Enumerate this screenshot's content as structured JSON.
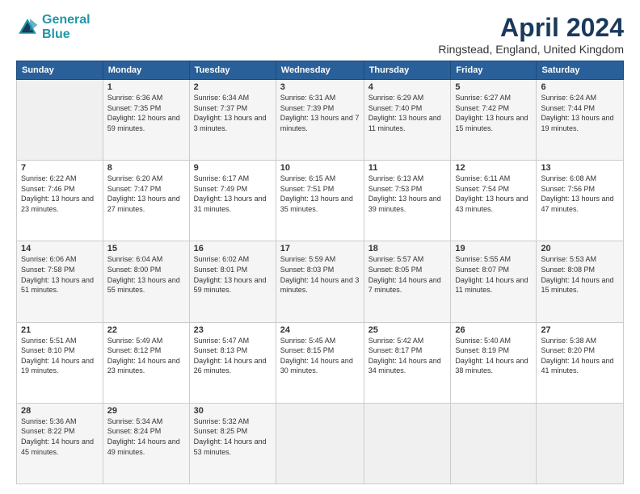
{
  "header": {
    "logo_general": "General",
    "logo_blue": "Blue",
    "month_year": "April 2024",
    "location": "Ringstead, England, United Kingdom"
  },
  "days_of_week": [
    "Sunday",
    "Monday",
    "Tuesday",
    "Wednesday",
    "Thursday",
    "Friday",
    "Saturday"
  ],
  "weeks": [
    [
      {
        "day": "",
        "sunrise": "",
        "sunset": "",
        "daylight": ""
      },
      {
        "day": "1",
        "sunrise": "Sunrise: 6:36 AM",
        "sunset": "Sunset: 7:35 PM",
        "daylight": "Daylight: 12 hours and 59 minutes."
      },
      {
        "day": "2",
        "sunrise": "Sunrise: 6:34 AM",
        "sunset": "Sunset: 7:37 PM",
        "daylight": "Daylight: 13 hours and 3 minutes."
      },
      {
        "day": "3",
        "sunrise": "Sunrise: 6:31 AM",
        "sunset": "Sunset: 7:39 PM",
        "daylight": "Daylight: 13 hours and 7 minutes."
      },
      {
        "day": "4",
        "sunrise": "Sunrise: 6:29 AM",
        "sunset": "Sunset: 7:40 PM",
        "daylight": "Daylight: 13 hours and 11 minutes."
      },
      {
        "day": "5",
        "sunrise": "Sunrise: 6:27 AM",
        "sunset": "Sunset: 7:42 PM",
        "daylight": "Daylight: 13 hours and 15 minutes."
      },
      {
        "day": "6",
        "sunrise": "Sunrise: 6:24 AM",
        "sunset": "Sunset: 7:44 PM",
        "daylight": "Daylight: 13 hours and 19 minutes."
      }
    ],
    [
      {
        "day": "7",
        "sunrise": "Sunrise: 6:22 AM",
        "sunset": "Sunset: 7:46 PM",
        "daylight": "Daylight: 13 hours and 23 minutes."
      },
      {
        "day": "8",
        "sunrise": "Sunrise: 6:20 AM",
        "sunset": "Sunset: 7:47 PM",
        "daylight": "Daylight: 13 hours and 27 minutes."
      },
      {
        "day": "9",
        "sunrise": "Sunrise: 6:17 AM",
        "sunset": "Sunset: 7:49 PM",
        "daylight": "Daylight: 13 hours and 31 minutes."
      },
      {
        "day": "10",
        "sunrise": "Sunrise: 6:15 AM",
        "sunset": "Sunset: 7:51 PM",
        "daylight": "Daylight: 13 hours and 35 minutes."
      },
      {
        "day": "11",
        "sunrise": "Sunrise: 6:13 AM",
        "sunset": "Sunset: 7:53 PM",
        "daylight": "Daylight: 13 hours and 39 minutes."
      },
      {
        "day": "12",
        "sunrise": "Sunrise: 6:11 AM",
        "sunset": "Sunset: 7:54 PM",
        "daylight": "Daylight: 13 hours and 43 minutes."
      },
      {
        "day": "13",
        "sunrise": "Sunrise: 6:08 AM",
        "sunset": "Sunset: 7:56 PM",
        "daylight": "Daylight: 13 hours and 47 minutes."
      }
    ],
    [
      {
        "day": "14",
        "sunrise": "Sunrise: 6:06 AM",
        "sunset": "Sunset: 7:58 PM",
        "daylight": "Daylight: 13 hours and 51 minutes."
      },
      {
        "day": "15",
        "sunrise": "Sunrise: 6:04 AM",
        "sunset": "Sunset: 8:00 PM",
        "daylight": "Daylight: 13 hours and 55 minutes."
      },
      {
        "day": "16",
        "sunrise": "Sunrise: 6:02 AM",
        "sunset": "Sunset: 8:01 PM",
        "daylight": "Daylight: 13 hours and 59 minutes."
      },
      {
        "day": "17",
        "sunrise": "Sunrise: 5:59 AM",
        "sunset": "Sunset: 8:03 PM",
        "daylight": "Daylight: 14 hours and 3 minutes."
      },
      {
        "day": "18",
        "sunrise": "Sunrise: 5:57 AM",
        "sunset": "Sunset: 8:05 PM",
        "daylight": "Daylight: 14 hours and 7 minutes."
      },
      {
        "day": "19",
        "sunrise": "Sunrise: 5:55 AM",
        "sunset": "Sunset: 8:07 PM",
        "daylight": "Daylight: 14 hours and 11 minutes."
      },
      {
        "day": "20",
        "sunrise": "Sunrise: 5:53 AM",
        "sunset": "Sunset: 8:08 PM",
        "daylight": "Daylight: 14 hours and 15 minutes."
      }
    ],
    [
      {
        "day": "21",
        "sunrise": "Sunrise: 5:51 AM",
        "sunset": "Sunset: 8:10 PM",
        "daylight": "Daylight: 14 hours and 19 minutes."
      },
      {
        "day": "22",
        "sunrise": "Sunrise: 5:49 AM",
        "sunset": "Sunset: 8:12 PM",
        "daylight": "Daylight: 14 hours and 23 minutes."
      },
      {
        "day": "23",
        "sunrise": "Sunrise: 5:47 AM",
        "sunset": "Sunset: 8:13 PM",
        "daylight": "Daylight: 14 hours and 26 minutes."
      },
      {
        "day": "24",
        "sunrise": "Sunrise: 5:45 AM",
        "sunset": "Sunset: 8:15 PM",
        "daylight": "Daylight: 14 hours and 30 minutes."
      },
      {
        "day": "25",
        "sunrise": "Sunrise: 5:42 AM",
        "sunset": "Sunset: 8:17 PM",
        "daylight": "Daylight: 14 hours and 34 minutes."
      },
      {
        "day": "26",
        "sunrise": "Sunrise: 5:40 AM",
        "sunset": "Sunset: 8:19 PM",
        "daylight": "Daylight: 14 hours and 38 minutes."
      },
      {
        "day": "27",
        "sunrise": "Sunrise: 5:38 AM",
        "sunset": "Sunset: 8:20 PM",
        "daylight": "Daylight: 14 hours and 41 minutes."
      }
    ],
    [
      {
        "day": "28",
        "sunrise": "Sunrise: 5:36 AM",
        "sunset": "Sunset: 8:22 PM",
        "daylight": "Daylight: 14 hours and 45 minutes."
      },
      {
        "day": "29",
        "sunrise": "Sunrise: 5:34 AM",
        "sunset": "Sunset: 8:24 PM",
        "daylight": "Daylight: 14 hours and 49 minutes."
      },
      {
        "day": "30",
        "sunrise": "Sunrise: 5:32 AM",
        "sunset": "Sunset: 8:25 PM",
        "daylight": "Daylight: 14 hours and 53 minutes."
      },
      {
        "day": "",
        "sunrise": "",
        "sunset": "",
        "daylight": ""
      },
      {
        "day": "",
        "sunrise": "",
        "sunset": "",
        "daylight": ""
      },
      {
        "day": "",
        "sunrise": "",
        "sunset": "",
        "daylight": ""
      },
      {
        "day": "",
        "sunrise": "",
        "sunset": "",
        "daylight": ""
      }
    ]
  ]
}
